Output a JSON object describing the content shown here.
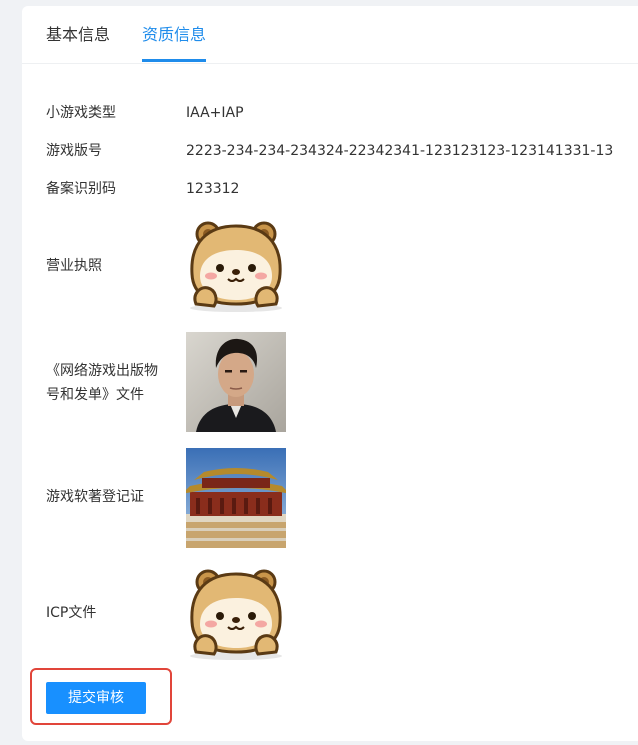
{
  "tabs": [
    {
      "label": "基本信息",
      "active": false
    },
    {
      "label": "资质信息",
      "active": true
    }
  ],
  "fields": [
    {
      "label": "小游戏类型",
      "value": "IAA+IAP"
    },
    {
      "label": "游戏版号",
      "value": "2223-234-234-234324-22342341-123123123-123141331-13"
    },
    {
      "label": "备案识别码",
      "value": "123312"
    }
  ],
  "images": {
    "business_license": {
      "label": "营业执照",
      "image": "hamster-cartoon"
    },
    "publication_doc": {
      "label_line1": "《网络游戏出版物",
      "label_line2": "号和发单》文件",
      "image": "man-portrait-photo"
    },
    "software_copyright": {
      "label": "游戏软著登记证",
      "image": "forbidden-city-photo"
    },
    "icp": {
      "label": "ICP文件",
      "image": "hamster-cartoon"
    }
  },
  "submit_label": "提交审核",
  "colors": {
    "accent": "#1f8ceb",
    "button": "#1890ff",
    "highlight": "#e1453a"
  }
}
